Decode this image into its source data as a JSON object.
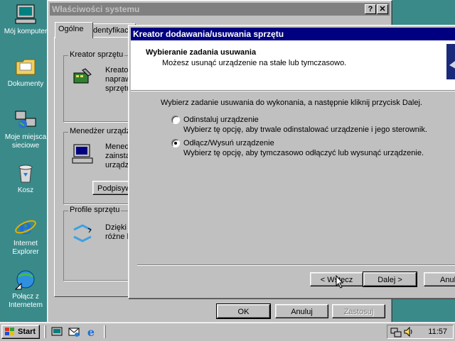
{
  "desktop": {
    "icons": [
      {
        "label": "Mój komputer"
      },
      {
        "label": "Dokumenty"
      },
      {
        "label": "Moje miejsca sieciowe"
      },
      {
        "label": "Kosz"
      },
      {
        "label": "Internet Explorer"
      },
      {
        "label": "Połącz z Internetem"
      }
    ]
  },
  "system_properties": {
    "title": "Właściwości systemu",
    "tabs": [
      "Ogólne",
      "Identyfikac"
    ],
    "groups": {
      "wizard": {
        "title": "Kreator sprzętu",
        "lines": [
          "Kreator",
          "naprawi",
          "sprzętu"
        ]
      },
      "manager": {
        "title": "Menedżer urządze",
        "lines": [
          "Mened",
          "zainsta",
          "urządz"
        ],
        "button": "Podpisyw"
      },
      "profiles": {
        "title": "Profile sprzętu",
        "lines": [
          "Dzięki",
          "różne k"
        ]
      }
    },
    "buttons": {
      "ok": "OK",
      "cancel": "Anuluj",
      "apply": "Zastosuj"
    }
  },
  "wizard": {
    "title": "Kreator dodawania/usuwania sprzętu",
    "heading": "Wybieranie zadania usuwania",
    "subheading": "Możesz usunąć urządzenie na stałe lub tymczasowo.",
    "instruction": "Wybierz zadanie usuwania do wykonania, a następnie kliknij przycisk Dalej.",
    "options": [
      {
        "label": "Odinstaluj urządzenie",
        "description": "Wybierz tę opcję, aby trwale odinstalować urządzenie i jego sterownik.",
        "selected": false
      },
      {
        "label": "Odłącz/Wysuń urządzenie",
        "description": "Wybierz tę opcję, aby tymczasowo odłączyć lub wysunąć urządzenie.",
        "selected": true
      }
    ],
    "buttons": {
      "back": "< Wstecz",
      "next": "Dalej >",
      "cancel": "Anul"
    }
  },
  "taskbar": {
    "start_label": "Start",
    "clock": "11:57"
  },
  "colors": {
    "desktop": "#3a8a8a",
    "active_title": "#000080",
    "inactive_title": "#808080"
  }
}
